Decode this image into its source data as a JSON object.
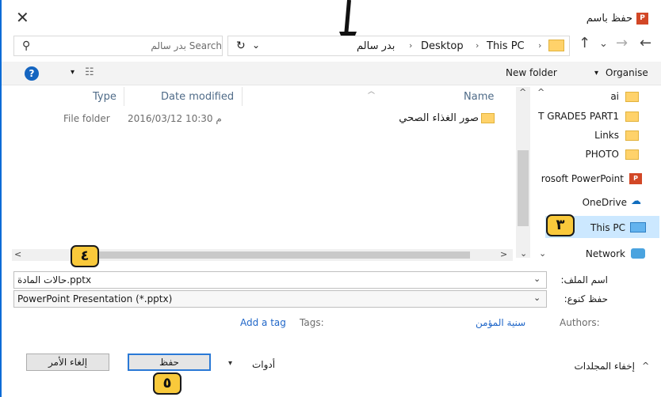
{
  "window": {
    "title": "حفظ باسم",
    "app_badge": "P",
    "close_glyph": "✕"
  },
  "address": {
    "crumbs": [
      "This PC",
      "Desktop",
      "بدر سالم"
    ],
    "separator": "›",
    "back_glyph": "←",
    "forward_glyph": "→",
    "up_glyph": "↑",
    "recent_glyph": "⌄",
    "refresh_glyph": "↻",
    "dropdown_glyph": "⌄"
  },
  "search": {
    "placeholder": "Search بدر سالم",
    "icon_glyph": "⚲"
  },
  "toolbar": {
    "organise": "Organise",
    "organise_caret": "▾",
    "new_folder": "New folder",
    "view_caret": "▾",
    "view_glyph": "☷",
    "help_glyph": "?"
  },
  "columns": {
    "name": "Name",
    "date_modified": "Date modified",
    "type": "Type"
  },
  "files": [
    {
      "name": "صور الغذاء الصحي",
      "date": "2016/03/12 م 10:30",
      "type": "File folder"
    }
  ],
  "nav_pane": {
    "items": [
      {
        "label": "ai",
        "icon": "folder-icon"
      },
      {
        "label": "T GRADE5 PART1",
        "icon": "folder-icon"
      },
      {
        "label": "Links",
        "icon": "folder-icon"
      },
      {
        "label": "PHOTO",
        "icon": "folder-icon"
      },
      {
        "label": "rosoft PowerPoint",
        "icon": "powerpoint-icon"
      },
      {
        "label": "OneDrive",
        "icon": "cloud-icon"
      },
      {
        "label": "This PC",
        "icon": "computer-icon",
        "selected": true
      },
      {
        "label": "Network",
        "icon": "network-icon"
      }
    ],
    "cloud_glyph": "☁"
  },
  "scroll": {
    "up": "^",
    "down": "⌄",
    "left": "<",
    "right": ">"
  },
  "form": {
    "filename_label": "اسم الملف:",
    "filename_value": "حالات المادة.pptx",
    "savetype_label": "حفظ كنوع:",
    "savetype_value": "PowerPoint Presentation (*.pptx)",
    "authors_label": "Authors:",
    "authors_value": "سنية المؤمن",
    "tags_label": "Tags:",
    "tags_value": "Add a tag",
    "dropdown_glyph": "⌄"
  },
  "footer": {
    "hide_folders": "إخفاء المجلدات",
    "hide_caret": "^",
    "tools": "أدوات",
    "tools_caret": "▾",
    "save": "حفظ",
    "cancel": "إلغاء الأمر"
  },
  "annotations": {
    "step3": "٣",
    "step4": "٤",
    "step5": "٥"
  },
  "colors": {
    "accent": "#1f66c8",
    "selection": "#cce8ff",
    "badge": "#f9c93b",
    "ppt": "#d24726"
  }
}
